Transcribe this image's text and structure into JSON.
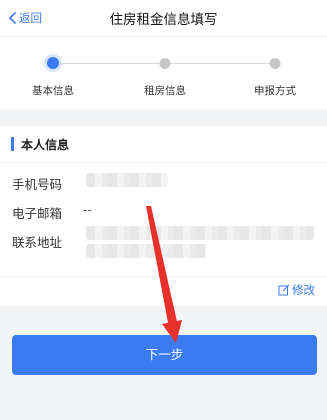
{
  "header": {
    "back_label": "返回",
    "title": "住房租金信息填写",
    "accent_color": "#3a7bf2"
  },
  "steps": {
    "items": [
      {
        "label": "基本信息",
        "active": true
      },
      {
        "label": "租房信息",
        "active": false
      },
      {
        "label": "申报方式",
        "active": false
      }
    ]
  },
  "personal_info": {
    "section_title": "本人信息",
    "fields": [
      {
        "label": "手机号码",
        "value": ""
      },
      {
        "label": "电子邮箱",
        "value": "--"
      },
      {
        "label": "联系地址",
        "value": ""
      }
    ],
    "edit_label": "修改"
  },
  "footer": {
    "next_label": "下一步"
  },
  "annotation": {
    "arrow_color": "#e8302c"
  }
}
